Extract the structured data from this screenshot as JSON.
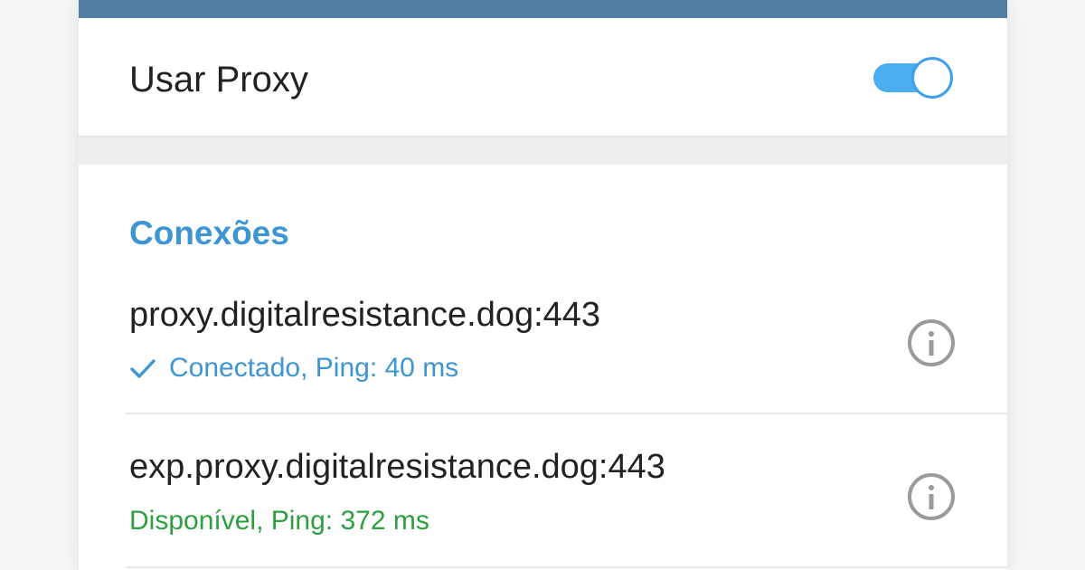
{
  "colors": {
    "accent": "#3d95d1",
    "header_blue": "#517da2",
    "switch_track": "#4aaef0",
    "switch_thumb_border": "#3e9ff0",
    "connected_blue": "#3d95d1",
    "available_green": "#2c9f3f",
    "info_gray": "#9a9a9a"
  },
  "proxy_toggle": {
    "label": "Usar Proxy",
    "enabled": true
  },
  "connections": {
    "title": "Conexões",
    "items": [
      {
        "host": "proxy.digitalresistance.dog:443",
        "status": "Conectado, Ping: 40 ms",
        "status_kind": "connected",
        "check_icon": "check-icon",
        "info_icon": "info-icon"
      },
      {
        "host": "exp.proxy.digitalresistance.dog:443",
        "status": "Disponível, Ping: 372 ms",
        "status_kind": "available",
        "info_icon": "info-icon"
      }
    ]
  }
}
